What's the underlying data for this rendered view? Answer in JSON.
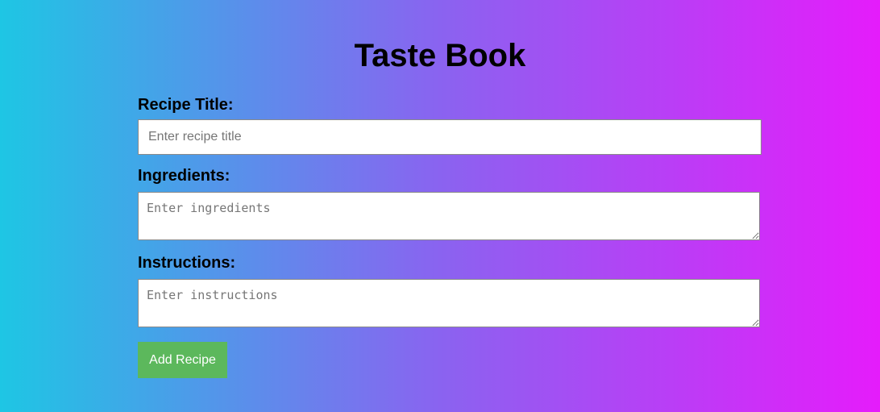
{
  "page": {
    "title": "Taste Book"
  },
  "form": {
    "recipe_title": {
      "label": "Recipe Title:",
      "placeholder": "Enter recipe title",
      "value": ""
    },
    "ingredients": {
      "label": "Ingredients:",
      "placeholder": "Enter ingredients",
      "value": ""
    },
    "instructions": {
      "label": "Instructions:",
      "placeholder": "Enter instructions",
      "value": ""
    },
    "submit_label": "Add Recipe"
  },
  "colors": {
    "gradient_start": "#1ec6e4",
    "gradient_end": "#e51cfb",
    "button_background": "#5cb85c",
    "button_text": "#ffffff"
  }
}
